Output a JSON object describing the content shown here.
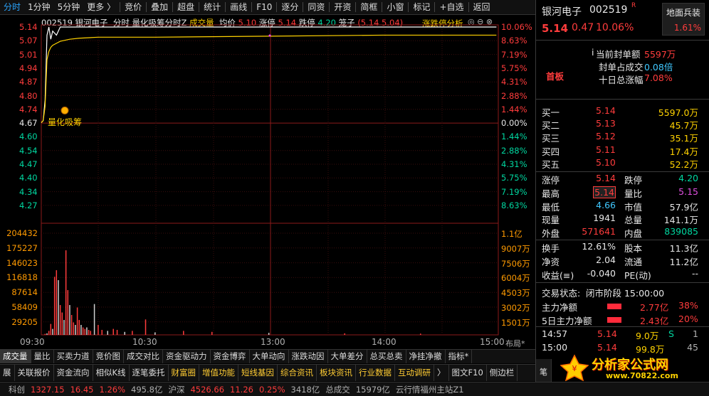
{
  "toolbar": {
    "tabs": [
      {
        "label": "分时",
        "active": true
      },
      {
        "label": "1分钟"
      },
      {
        "label": "5分钟"
      },
      {
        "label": "更多 〉"
      },
      {
        "label": "竞价"
      },
      {
        "label": "叠加"
      },
      {
        "label": "超盘"
      },
      {
        "label": "统计"
      },
      {
        "label": "画线"
      },
      {
        "label": "F10"
      },
      {
        "label": "逐分"
      },
      {
        "label": "同资"
      },
      {
        "label": "开资"
      },
      {
        "label": "简框"
      },
      {
        "label": "小窗"
      },
      {
        "label": "标记"
      },
      {
        "label": "+自选"
      },
      {
        "label": "返回"
      }
    ]
  },
  "chart_header": {
    "code": "002519",
    "name": "银河电子",
    "mode": "分时",
    "indicator": "量化吸筹分时Z",
    "vol_label": "成交量",
    "avg_label": "均价",
    "avg_val": "5.10",
    "zt_label": "涨停",
    "zt_val": "5.14",
    "dt_label": "跌停",
    "dt_val": "4.20",
    "bz_label": "笼子",
    "bz_val": "(5.14 5.04)",
    "analysis_label": "涨跌停分析"
  },
  "signal_label": "量化吸筹",
  "price_axis": {
    "left": [
      "5.14",
      "5.07",
      "5.01",
      "4.94",
      "4.87",
      "4.80",
      "4.74",
      "4.67",
      "4.60",
      "4.54",
      "4.47",
      "4.40",
      "4.34",
      "4.27"
    ],
    "right": [
      "10.06%",
      "8.63%",
      "7.19%",
      "5.75%",
      "4.31%",
      "2.88%",
      "1.44%",
      "0.00%",
      "1.44%",
      "2.88%",
      "4.31%",
      "5.75%",
      "7.19%",
      "8.63%"
    ]
  },
  "volume_axis": {
    "left": [
      "204432",
      "175227",
      "146023",
      "116818",
      "87614",
      "58409",
      "29205"
    ],
    "right": [
      "1.1亿",
      "9007万",
      "7506万",
      "6004万",
      "4503万",
      "3002万",
      "1501万"
    ]
  },
  "time_axis": [
    "09:30",
    "10:30",
    "13:00",
    "14:00",
    "15:00"
  ],
  "time_axis_extra": "布局*",
  "chart_data": {
    "type": "line",
    "x": [
      "09:30",
      "09:31",
      "09:32",
      "09:33",
      "09:34",
      "09:35",
      "09:36",
      "09:38",
      "09:40",
      "09:45",
      "09:50",
      "10:00",
      "10:30",
      "11:30",
      "13:00",
      "14:00",
      "15:00"
    ],
    "series": [
      {
        "values": [
          4.67,
          4.68,
          4.78,
          5.1,
          5.14,
          5.08,
          5.12,
          5.1,
          5.14,
          5.14,
          5.14,
          5.14,
          5.14,
          5.14,
          5.14,
          5.14,
          5.14
        ]
      },
      {
        "values": [
          4.67,
          4.68,
          4.75,
          4.98,
          5.02,
          5.04,
          5.05,
          5.06,
          5.07,
          5.08,
          5.085,
          5.09,
          5.09,
          5.095,
          5.095,
          5.1,
          5.1
        ]
      }
    ],
    "ylim": [
      4.2,
      5.14
    ],
    "volume": {
      "x_index": [
        2,
        3,
        4,
        5,
        6,
        7,
        8,
        9,
        10,
        11,
        12,
        13,
        14,
        15,
        16,
        17,
        18,
        19,
        20,
        21,
        22,
        23,
        24,
        25,
        26,
        28,
        30,
        32,
        35,
        38,
        40,
        44,
        48,
        55,
        60,
        75,
        90,
        120,
        160,
        200
      ],
      "values": [
        2000,
        3000,
        8000,
        22000,
        12000,
        116818,
        130000,
        110000,
        60000,
        45000,
        30000,
        170000,
        90000,
        60000,
        40000,
        25000,
        20000,
        55000,
        30000,
        20000,
        15000,
        12000,
        15000,
        10000,
        8000,
        62000,
        20000,
        10000,
        8000,
        12000,
        10000,
        6000,
        8000,
        31000,
        5000,
        8000,
        6000,
        4000,
        3000,
        2500
      ],
      "ylim": [
        0,
        204432
      ]
    }
  },
  "bottom_tabs_1": [
    "成交量",
    "量比",
    "买卖力道",
    "竞价图",
    "成交对比",
    "资金驱动力",
    "资金博弈",
    "大单动向",
    "涨跌动因",
    "大单差分",
    "总买总卖",
    "净挂净撤",
    "指标*"
  ],
  "bottom_tabs_2": [
    "展",
    "关联报价",
    "资金流向",
    "相似K线",
    "逐笔委托",
    "财富圈",
    "增值功能",
    "短线基因",
    "综合资讯",
    "板块资讯",
    "行业数据",
    "互动调研",
    "〉",
    "图文F10",
    "侧边栏"
  ],
  "panel": {
    "name": "银河电子",
    "code": "002519",
    "r_badge": "R",
    "sector": "地面兵装",
    "sector_pct": "1.61%",
    "price": "5.14",
    "chg": "0.47",
    "pct": "10.06%",
    "seal_amt_label": "当前封单额",
    "seal_amt": "5597万",
    "seal_ratio_label": "封单占成交",
    "seal_ratio": "0.08倍",
    "ten_day_label": "十日总涨幅",
    "ten_day": "7.08%",
    "board_label": "首板",
    "bids": [
      {
        "label": "买一",
        "price": "5.14",
        "vol": "5597.0万"
      },
      {
        "label": "买二",
        "price": "5.13",
        "vol": "45.7万"
      },
      {
        "label": "买三",
        "price": "5.12",
        "vol": "35.1万"
      },
      {
        "label": "买四",
        "price": "5.11",
        "vol": "17.4万"
      },
      {
        "label": "买五",
        "price": "5.10",
        "vol": "52.2万"
      }
    ],
    "stats": [
      {
        "l1": "涨停",
        "v1": "5.14",
        "l2": "跌停",
        "v2": "4.20"
      },
      {
        "l1": "最高",
        "v1": "5.14",
        "l2": "量比",
        "v2": "5.15"
      },
      {
        "l1": "最低",
        "v1": "4.66",
        "l2": "市值",
        "v2": "57.9亿"
      },
      {
        "l1": "现量",
        "v1": "1941",
        "l2": "总量",
        "v2": "141.1万"
      },
      {
        "l1": "外盘",
        "v1": "571641",
        "l2": "内盘",
        "v2": "839085"
      }
    ],
    "stats2": [
      {
        "l1": "换手",
        "v1": "12.61%",
        "l2": "股本",
        "v2": "11.3亿"
      },
      {
        "l1": "净资",
        "v1": "2.04",
        "l2": "流通",
        "v2": "11.2亿"
      },
      {
        "l1": "收益(≡)",
        "v1": "-0.040",
        "l2": "PE(动)",
        "v2": "--"
      }
    ],
    "trade_state_label": "交易状态:",
    "trade_state": "闭市阶段 15:00:00",
    "main_flow_label": "主力净额",
    "main_flow_val": "2.77亿",
    "main_flow_pct": "38%",
    "main_flow5_label": "5日主力净额",
    "main_flow5_val": "2.43亿",
    "main_flow5_pct": "20%",
    "ticks": [
      {
        "time": "14:57",
        "price": "5.14",
        "vol": "9.0万",
        "flag": "S",
        "n": "1"
      },
      {
        "time": "15:00",
        "price": "5.14",
        "vol": "99.8万",
        "flag": "",
        "n": "45"
      }
    ],
    "watermark": "分析家公式网",
    "watermark_url": "www.70822.com",
    "side_tab": "笔"
  },
  "status": {
    "items": [
      {
        "t": "科创",
        "c": "gry"
      },
      {
        "t": "1327.15",
        "c": "red"
      },
      {
        "t": "16.45",
        "c": "red"
      },
      {
        "t": "1.26%",
        "c": "red"
      },
      {
        "t": "495.8亿",
        "c": "gry"
      },
      {
        "t": "沪深",
        "c": "gry"
      },
      {
        "t": "4526.66",
        "c": "red"
      },
      {
        "t": "11.26",
        "c": "red"
      },
      {
        "t": "0.25%",
        "c": "red"
      },
      {
        "t": "3418亿",
        "c": "gry"
      },
      {
        "t": "总成交",
        "c": "gry"
      },
      {
        "t": "15979亿",
        "c": "gry"
      },
      {
        "t": "云行情福州主站Z1",
        "c": "gry"
      }
    ]
  }
}
